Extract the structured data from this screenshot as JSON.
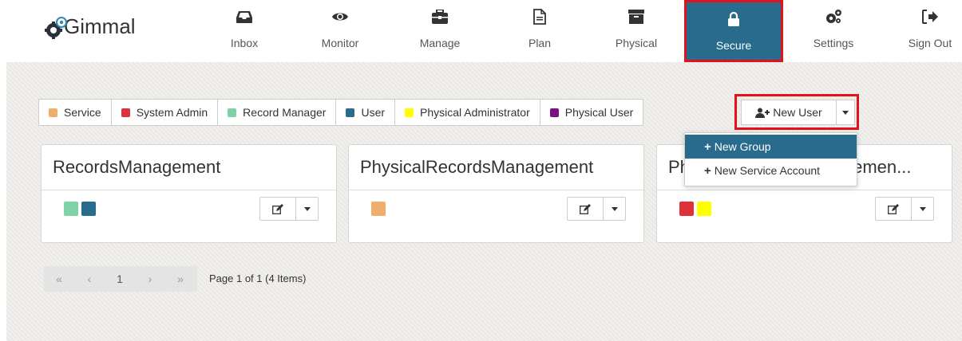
{
  "app": {
    "logo_text": "Gimmal"
  },
  "nav": {
    "items": [
      {
        "label": "Inbox",
        "icon": "inbox-icon"
      },
      {
        "label": "Monitor",
        "icon": "eye-icon"
      },
      {
        "label": "Manage",
        "icon": "briefcase-icon"
      },
      {
        "label": "Plan",
        "icon": "document-icon"
      },
      {
        "label": "Physical",
        "icon": "archive-box-icon"
      },
      {
        "label": "Secure",
        "icon": "lock-icon",
        "active": true
      },
      {
        "label": "Settings",
        "icon": "gears-icon"
      },
      {
        "label": "Sign Out",
        "icon": "sign-out-icon"
      }
    ],
    "active_color": "#286b8c"
  },
  "filters": [
    {
      "label": "Service",
      "color": "#f0ad6b"
    },
    {
      "label": "System Admin",
      "color": "#e0303a"
    },
    {
      "label": "Record Manager",
      "color": "#7ed3a4"
    },
    {
      "label": "User",
      "color": "#286b8c"
    },
    {
      "label": "Physical Administrator",
      "color": "#ffff00"
    },
    {
      "label": "Physical User",
      "color": "#7a137f"
    }
  ],
  "new_user": {
    "label": "New User",
    "icon": "add-user-icon"
  },
  "dropdown": {
    "items": [
      {
        "label": "New Group",
        "active": true
      },
      {
        "label": "New Service Account"
      }
    ]
  },
  "cards": [
    {
      "title": "RecordsManagement",
      "swatches": [
        "#7ed3a4",
        "#286b8c"
      ]
    },
    {
      "title": "PhysicalRecordsManagement",
      "swatches": [
        "#f0ad6b"
      ]
    },
    {
      "title": "PhysicalRecordsManagemen...",
      "swatches": [
        "#e0303a",
        "#ffff00"
      ]
    }
  ],
  "pager": {
    "first": "«",
    "prev": "‹",
    "page": "1",
    "next": "›",
    "last": "»",
    "info": "Page 1 of 1 (4 Items)"
  },
  "highlight_color": "#e0121b"
}
